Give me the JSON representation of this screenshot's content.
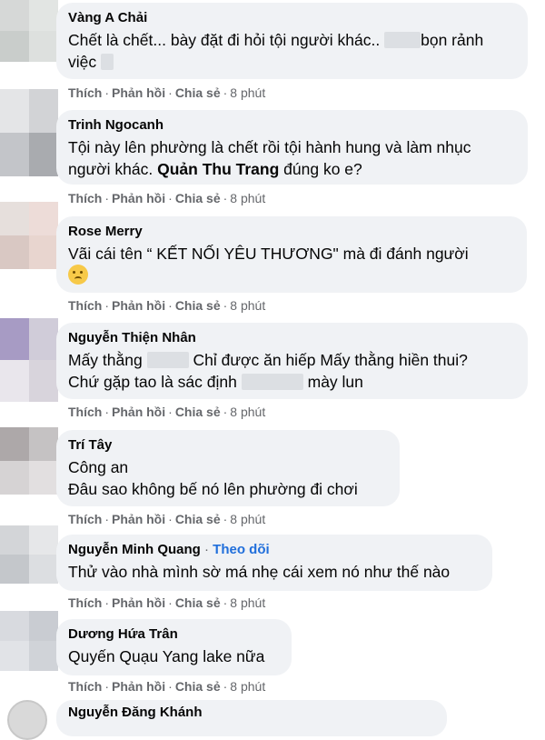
{
  "actions": {
    "like": "Thích",
    "reply": "Phản hồi",
    "share": "Chia sẻ",
    "separator": "·"
  },
  "comments": [
    {
      "name": "Vàng A Chải",
      "line1a": "Chết là chết... bày đặt đi hỏi tội người khác..",
      "line1b": "bọn rảnh",
      "line2": "việc",
      "time": "8 phút"
    },
    {
      "name": "Trinh Ngocanh",
      "line1": "Tội này lên phường là chết rồi tội hành hung và làm nhục",
      "line2a": "người khác.",
      "mention": "Quản Thu Trang",
      "line2b": "đúng ko e?",
      "time": "8 phút"
    },
    {
      "name": "Rose Merry",
      "line1": "Vãi cái tên “ KẾT NỐI YÊU THƯƠNG\" mà đi đánh người",
      "emoji": "thinking-face-icon",
      "time": "8 phút"
    },
    {
      "name": "Nguyễn Thiện Nhân",
      "line1a": "Mấy thằng",
      "line1b": "Chỉ được ăn hiếp Mấy thằng hiền thui?",
      "line2a": "Chứ gặp tao là sác định",
      "line2b": "mày lun",
      "time": "8 phút"
    },
    {
      "name": "Trí Tây",
      "line1": "Công an",
      "line2": "Đâu sao không bế nó lên phường đi chơi",
      "time": "8 phút"
    },
    {
      "name": "Nguyễn Minh Quang",
      "follow": "Theo dõi",
      "line1": "Thử vào nhà mình sờ má nhẹ cái xem nó như thế nào",
      "time": "8 phút"
    },
    {
      "name": "Dương Hứa Trân",
      "line1": "Quyến Quạu Yang lake nữa",
      "time": "8 phút"
    }
  ],
  "partial": {
    "name": "Nguyễn Đăng Khánh"
  },
  "colors": {
    "bubble": "#f0f2f5",
    "action_text": "#65676b",
    "follow_link": "#216fdb"
  }
}
